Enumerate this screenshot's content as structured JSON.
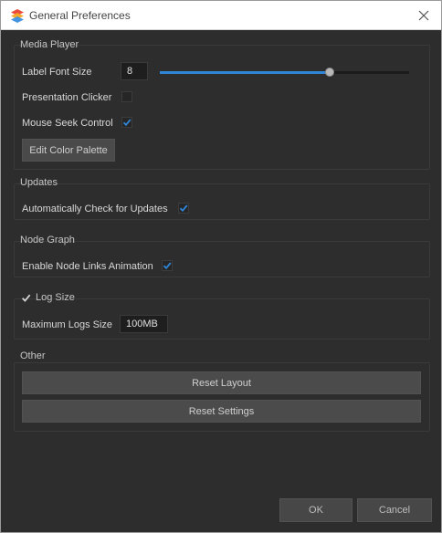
{
  "window": {
    "title": "General Preferences",
    "colors": {
      "accent": "#2f86d6",
      "background": "#2d2d2d"
    }
  },
  "media_player": {
    "title": "Media Player",
    "label_font_size_label": "Label Font Size",
    "label_font_size_value": "8",
    "label_font_size_fraction": 0.68,
    "presentation_clicker_label": "Presentation Clicker",
    "presentation_clicker_checked": false,
    "mouse_seek_label": "Mouse Seek Control",
    "mouse_seek_checked": true,
    "edit_palette_label": "Edit Color Palette"
  },
  "updates": {
    "title": "Updates",
    "auto_check_label": "Automatically Check for Updates",
    "auto_check_checked": true
  },
  "node_graph": {
    "title": "Node Graph",
    "links_anim_label": "Enable Node Links Animation",
    "links_anim_checked": true
  },
  "log_size": {
    "title": "Log Size",
    "enabled": true,
    "max_logs_label": "Maximum Logs Size",
    "max_logs_value": "100MB"
  },
  "other": {
    "title": "Other",
    "reset_layout_label": "Reset Layout",
    "reset_settings_label": "Reset Settings"
  },
  "footer": {
    "ok_label": "OK",
    "cancel_label": "Cancel"
  }
}
